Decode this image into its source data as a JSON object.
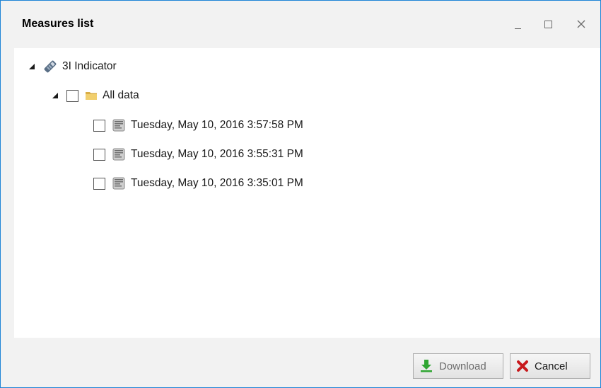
{
  "window": {
    "title": "Measures list",
    "controls": {
      "minimize_label": "_",
      "close_label": "X"
    }
  },
  "tree": {
    "root": {
      "label": "3I Indicator",
      "icon": "device-icon",
      "expanded": true
    },
    "folder": {
      "label": "All data",
      "icon": "folder-icon",
      "expanded": true,
      "checked": false
    },
    "measures": [
      {
        "label": "Tuesday, May 10, 2016 3:57:58 PM",
        "checked": false,
        "icon": "measure-icon"
      },
      {
        "label": "Tuesday, May 10, 2016 3:55:31 PM",
        "checked": false,
        "icon": "measure-icon"
      },
      {
        "label": "Tuesday, May 10, 2016 3:35:01 PM",
        "checked": false,
        "icon": "measure-icon"
      }
    ]
  },
  "footer": {
    "download_label": "Download",
    "download_enabled": false,
    "cancel_label": "Cancel"
  },
  "colors": {
    "window_border": "#1e84d6",
    "chrome_background": "#f2f2f2",
    "download_arrow": "#2fa632",
    "cancel_x": "#c8191c",
    "folder": "#e8c25a"
  }
}
